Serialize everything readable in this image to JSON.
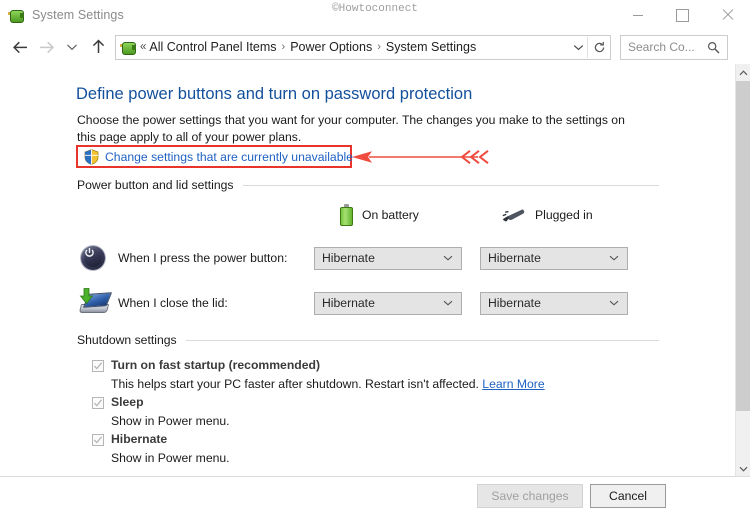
{
  "window": {
    "title": "System Settings",
    "icon": "power-options-icon",
    "watermark": "©Howtoconnect",
    "controls": {
      "minimize": "Minimize",
      "maximize": "Maximize",
      "close": "Close"
    }
  },
  "nav": {
    "back": "Back",
    "forward": "Forward",
    "recent": "Recent locations",
    "up": "Up one level",
    "breadcrumbs": [
      "All Control Panel Items",
      "Power Options",
      "System Settings"
    ],
    "address_overflow": "«",
    "refresh": "Refresh"
  },
  "search": {
    "placeholder": "Search Co...",
    "icon": "search-icon"
  },
  "page": {
    "title": "Define power buttons and turn on password protection",
    "description": "Choose the power settings that you want for your computer. The changes you make to the settings on this page apply to all of your power plans.",
    "uac_link": "Change settings that are currently unavailable"
  },
  "power_section": {
    "group_label": "Power button and lid settings",
    "columns": [
      {
        "label": "On battery",
        "icon": "battery-icon"
      },
      {
        "label": "Plugged in",
        "icon": "power-plug-icon"
      }
    ],
    "rows": [
      {
        "icon": "power-button-icon",
        "label": "When I press the power button:",
        "on_battery": "Hibernate",
        "plugged_in": "Hibernate"
      },
      {
        "icon": "laptop-lid-icon",
        "label": "When I close the lid:",
        "on_battery": "Hibernate",
        "plugged_in": "Hibernate"
      }
    ]
  },
  "shutdown_section": {
    "group_label": "Shutdown settings",
    "items": [
      {
        "label": "Turn on fast startup (recommended)",
        "checked": true,
        "description": "This helps start your PC faster after shutdown. Restart isn't affected.",
        "link": "Learn More"
      },
      {
        "label": "Sleep",
        "checked": true,
        "description": "Show in Power menu.",
        "link": ""
      },
      {
        "label": "Hibernate",
        "checked": true,
        "description": "Show in Power menu.",
        "link": ""
      }
    ]
  },
  "footer": {
    "save": "Save changes",
    "cancel": "Cancel"
  },
  "colors": {
    "heading_blue": "#13509c",
    "link_blue": "#1f62c4",
    "annotation_red": "#e8342a",
    "battery_green": "#74c63c"
  }
}
